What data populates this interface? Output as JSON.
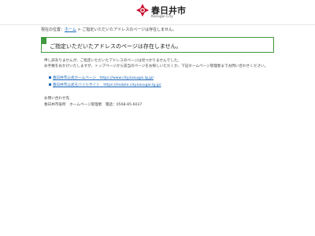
{
  "header": {
    "logo_text": "春日井市",
    "logo_sub": "Kasugai City",
    "brand_color": "#c8102e"
  },
  "breadcrumb": {
    "prefix": "現在の位置：",
    "home": "ホーム",
    "separator": " > ",
    "current": "ご指定いただいたアドレスのページは存在しません。"
  },
  "alert": {
    "title": "ご指定いただいたアドレスのページは存在しません。",
    "accent_color": "#3f9a3f"
  },
  "message": {
    "line1": "申し訳ありませんが、ご指定いただいたアドレスのページは見つかりませんでした。",
    "line2": "お手数をおかけいたしますが、トップページから該当のページをお探しいただくか、下記ホームページ管理者までお問い合わせください。"
  },
  "links": [
    {
      "label": "春日井市公式ホームページ",
      "url_text": "https://www.city.kasugai.lg.jp/"
    },
    {
      "label": "春日井市公式モバイルサイト",
      "url_text": "https://mobile.city.kasugai.lg.jp/"
    }
  ],
  "inquiry": {
    "title": "お問い合わせ先",
    "org": "春日井市役所",
    "dept": "ホームページ管理者",
    "tel_label": "電話：",
    "tel": "0568-85-6037"
  }
}
